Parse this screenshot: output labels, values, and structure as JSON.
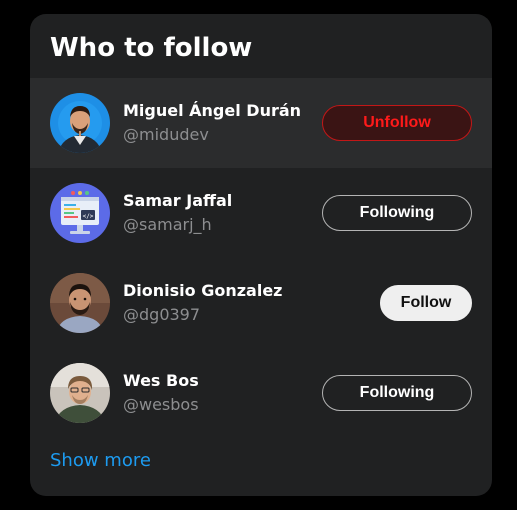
{
  "card": {
    "title": "Who to follow",
    "show_more": "Show more"
  },
  "users": [
    {
      "name": "Miguel Ángel Durán",
      "handle": "@midudev",
      "button_label": "Unfollow",
      "state": "unfollow-hover",
      "avatar_icon": "person-photo-icon"
    },
    {
      "name": "Samar Jaffal",
      "handle": "@samarj_h",
      "button_label": "Following",
      "state": "following",
      "avatar_icon": "code-monitor-icon"
    },
    {
      "name": "Dionisio Gonzalez",
      "handle": "@dg0397",
      "button_label": "Follow",
      "state": "follow",
      "avatar_icon": "person-photo-icon"
    },
    {
      "name": "Wes Bos",
      "handle": "@wesbos",
      "button_label": "Following",
      "state": "following",
      "avatar_icon": "person-photo-icon"
    }
  ],
  "colors": {
    "page_background": "#000000",
    "card_background": "#202122",
    "hover_row": "#2b2c2d",
    "link": "#1d9bf0",
    "unfollow_text": "#ff1a1a",
    "unfollow_border": "#c21717"
  }
}
